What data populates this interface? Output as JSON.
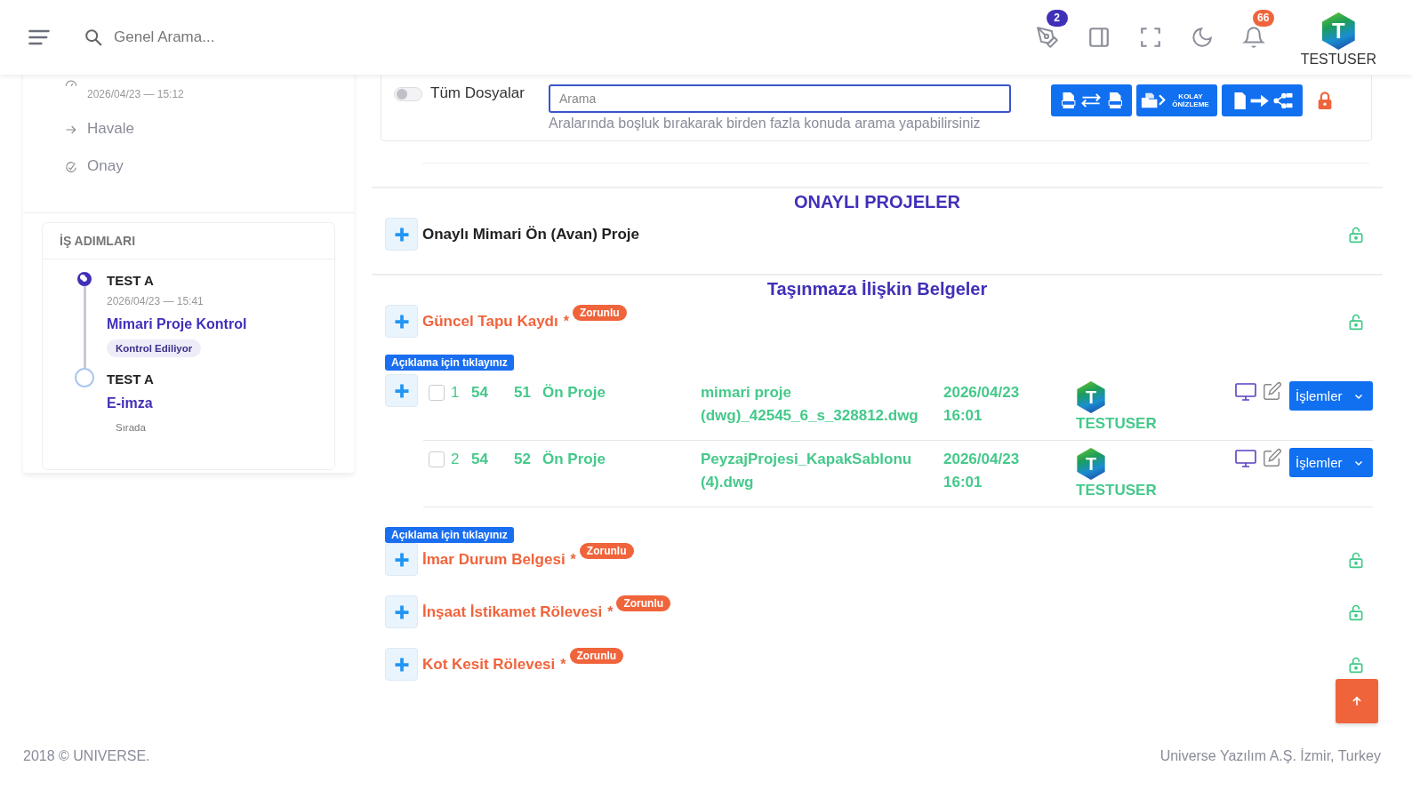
{
  "header": {
    "search": {
      "placeholder": "Genel Arama..."
    },
    "icons": [
      {
        "kind": "pen",
        "badge": "2"
      },
      {
        "kind": "panel"
      },
      {
        "kind": "fullscreen"
      },
      {
        "kind": "moon"
      },
      {
        "kind": "bell",
        "badge": "66"
      }
    ],
    "user": {
      "initial": "T",
      "name": "TESTUSER"
    }
  },
  "sidebar": {
    "history": [
      {
        "kind": "gauge",
        "date": "2026/04/23 — 15:12"
      },
      {
        "kind": "arrow",
        "label": "Havale"
      },
      {
        "kind": "check",
        "label": "Onay"
      }
    ],
    "steps_card": {
      "title": "İŞ ADIMLARI",
      "steps": [
        {
          "user": "TEST A",
          "date": "2026/04/23 — 15:41",
          "task": "Mimari Proje Kontrol",
          "status": "Kontrol Ediliyor",
          "current": true
        },
        {
          "user": "TEST A",
          "task": "E-imza",
          "status": "Sırada",
          "current": false
        }
      ]
    }
  },
  "filter": {
    "toggle": {
      "label": "Tüm Dosyalar",
      "on": false
    },
    "search": {
      "placeholder": "Arama",
      "hint": "Aralarında boşluk bırakarak birden fazla konuda arama yapabilirsiniz"
    },
    "actions": [
      {
        "kind": "convert"
      },
      {
        "kind": "preview",
        "label": "KOLAY ÖNİZLEME"
      },
      {
        "kind": "share"
      }
    ],
    "locked": true
  },
  "sections": [
    {
      "title": "ONAYLI PROJELER",
      "items": [
        {
          "kind": "document",
          "name": "Onaylı Mimari Ön (Avan) Proje",
          "required": false,
          "locked": false
        }
      ]
    },
    {
      "title": "Taşınmaza İlişkin Belgeler",
      "items": [
        {
          "kind": "document",
          "name": "Güncel Tapu Kaydı",
          "required": true,
          "mark": "*",
          "badge": "Zorunlu",
          "locked": false
        },
        {
          "kind": "note",
          "label": "Açıklama için tıklayınız"
        },
        {
          "kind": "file",
          "add": true,
          "checked": false,
          "no": "1",
          "column_3": "54",
          "column_4": "51",
          "type": "Ön Proje",
          "filename": "mimari proje (dwg)_42545_6_s_328812.dwg",
          "date": "2026/04/23 16:01",
          "user": {
            "initial": "T",
            "name": "TESTUSER"
          },
          "action": "İşlemler"
        },
        {
          "kind": "file",
          "add": false,
          "checked": false,
          "no": "2",
          "column_3": "54",
          "column_4": "52",
          "type": "Ön Proje",
          "filename": "PeyzajProjesi_KapakSablonu (4).dwg",
          "date": "2026/04/23 16:01",
          "user": {
            "initial": "T",
            "name": "TESTUSER"
          },
          "action": "İşlemler"
        },
        {
          "kind": "note",
          "label": "Açıklama için tıklayınız"
        },
        {
          "kind": "document",
          "name": "İmar Durum Belgesi",
          "required": true,
          "mark": "*",
          "badge": "Zorunlu",
          "locked": false
        },
        {
          "kind": "document",
          "name": "İnşaat İstikamet Rölevesi",
          "required": true,
          "mark": "*",
          "badge": "Zorunlu",
          "locked": false
        },
        {
          "kind": "document",
          "name": "Kot Kesit Rölevesi",
          "required": true,
          "mark": "*",
          "badge": "Zorunlu",
          "locked": false
        }
      ]
    }
  ],
  "footer": {
    "copyright": "2018 © UNIVERSE.",
    "company": "Universe Yazılım A.Ş. İzmir, Turkey"
  }
}
